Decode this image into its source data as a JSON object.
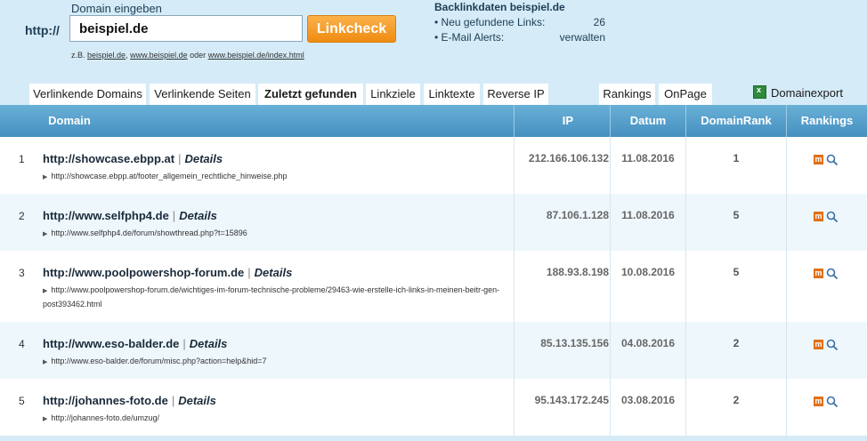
{
  "search": {
    "prefix": "http://",
    "label": "Domain eingeben",
    "value": "beispiel.de",
    "button": "Linkcheck",
    "example_prefix": "z.B.",
    "example_links": [
      "beispiel.de",
      "www.beispiel.de",
      "www.beispiel.de/index.html"
    ],
    "example_sep1": ",",
    "example_sep2": "oder"
  },
  "backlinks": {
    "title": "Backlinkdaten beispiel.de",
    "rows": [
      {
        "label": "• Neu gefundene Links:",
        "value": "26"
      },
      {
        "label": "• E-Mail Alerts:",
        "value": "verwalten"
      }
    ]
  },
  "tabs": [
    {
      "label": "Verlinkende Domains"
    },
    {
      "label": "Verlinkende Seiten"
    },
    {
      "label": "Zuletzt gefunden"
    },
    {
      "label": "Linkziele"
    },
    {
      "label": "Linktexte"
    },
    {
      "label": "Reverse IP"
    },
    {
      "label": "Rankings"
    },
    {
      "label": "OnPage"
    }
  ],
  "export_label": "Domainexport",
  "table": {
    "headers": {
      "domain": "Domain",
      "ip": "IP",
      "datum": "Datum",
      "rank": "DomainRank",
      "rankings": "Rankings"
    },
    "rows": [
      {
        "idx": "1",
        "domain": "http://showcase.ebpp.at",
        "sep": "|",
        "details": "Details",
        "path": "http://showcase.ebpp.at/footer_allgemein_rechtliche_hinweise.php",
        "ip": "212.166.106.132",
        "date": "11.08.2016",
        "rank": "1"
      },
      {
        "idx": "2",
        "domain": "http://www.selfphp4.de",
        "sep": "|",
        "details": "Details",
        "path": "http://www.selfphp4.de/forum/showthread.php?t=15896",
        "ip": "87.106.1.128",
        "date": "11.08.2016",
        "rank": "5"
      },
      {
        "idx": "3",
        "domain": "http://www.poolpowershop-forum.de",
        "sep": "|",
        "details": "Details",
        "path": "http://www.poolpowershop-forum.de/wichtiges-im-forum-technische-probleme/29463-wie-erstelle-ich-links-in-meinen-beitr-gen-post393462.html",
        "ip": "188.93.8.198",
        "date": "10.08.2016",
        "rank": "5"
      },
      {
        "idx": "4",
        "domain": "http://www.eso-balder.de",
        "sep": "|",
        "details": "Details",
        "path": "http://www.eso-balder.de/forum/misc.php?action=help&hid=7",
        "ip": "85.13.135.156",
        "date": "04.08.2016",
        "rank": "2"
      },
      {
        "idx": "5",
        "domain": "http://johannes-foto.de",
        "sep": "|",
        "details": "Details",
        "path": "http://johannes-foto.de/umzug/",
        "ip": "95.143.172.245",
        "date": "03.08.2016",
        "rank": "2"
      }
    ],
    "ranking_icon_letter": "m"
  }
}
